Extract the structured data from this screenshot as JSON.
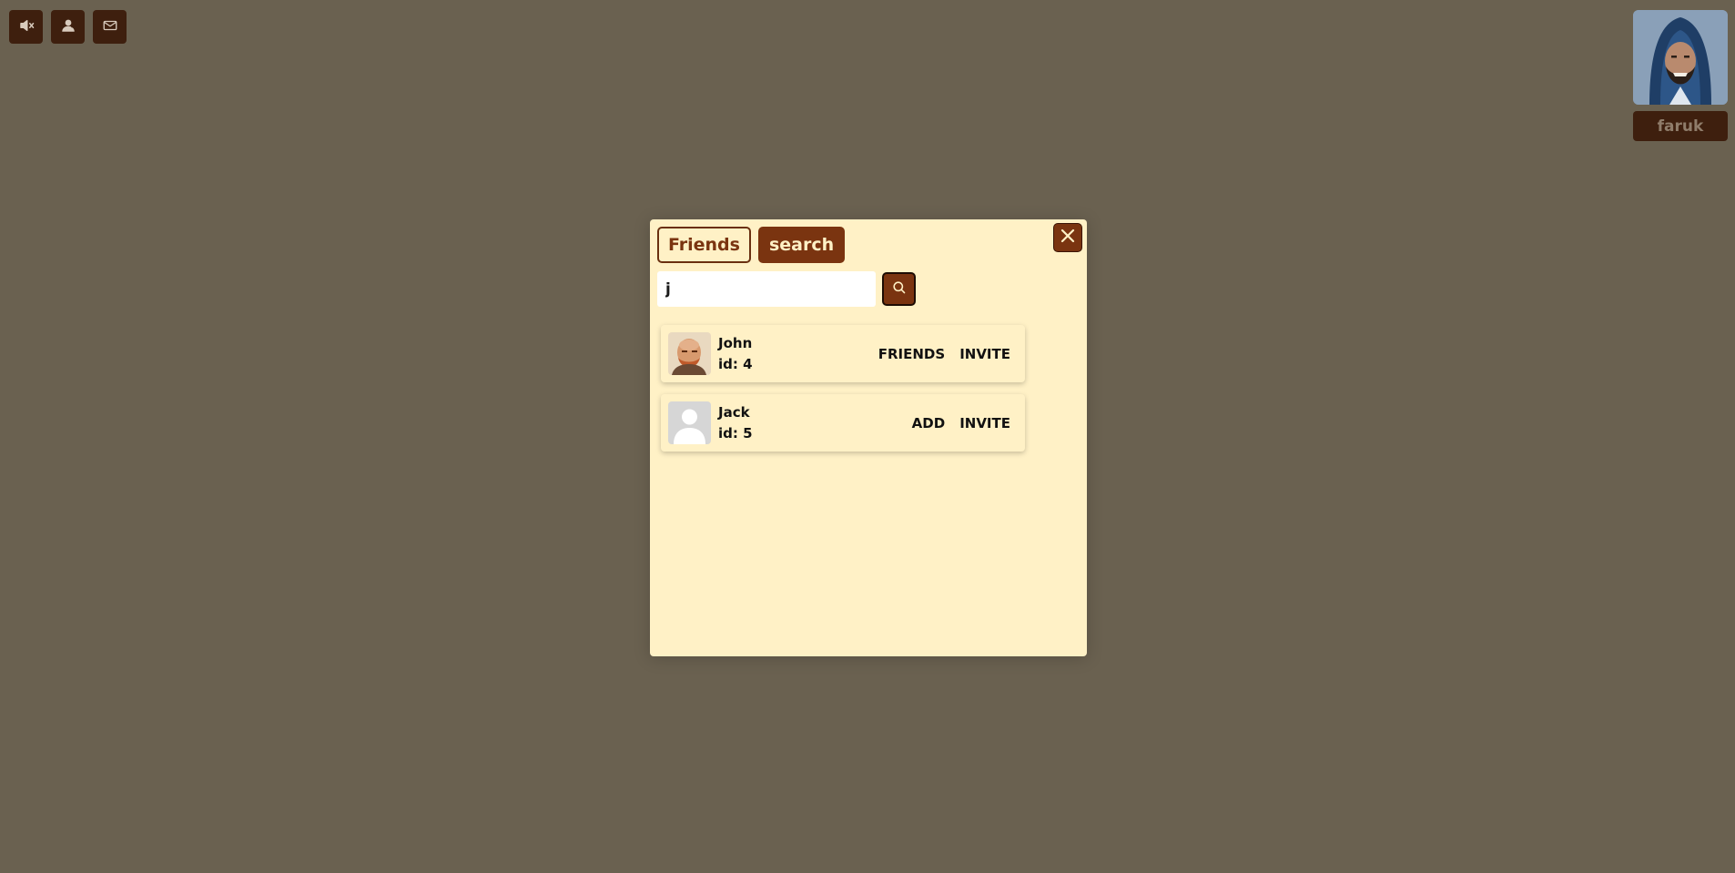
{
  "toolbar": {
    "icons": [
      "mute-icon",
      "friends-icon",
      "mail-icon"
    ]
  },
  "profile": {
    "name": "faruk"
  },
  "modal": {
    "tabs": [
      {
        "label": "Friends",
        "active": false
      },
      {
        "label": "search",
        "active": true
      }
    ],
    "search": {
      "value": "j"
    },
    "results": [
      {
        "name": "John",
        "id_text": "id: 4",
        "status_action": "FRIENDS",
        "invite_action": "INVITE",
        "avatar": "john-avatar"
      },
      {
        "name": "Jack",
        "id_text": "id: 5",
        "status_action": "ADD",
        "invite_action": "INVITE",
        "avatar": "default-avatar"
      }
    ]
  },
  "colors": {
    "background": "#6a6150",
    "panel": "#fff1c6",
    "accent": "#7a3410",
    "dark_button": "#3e1f0e"
  }
}
